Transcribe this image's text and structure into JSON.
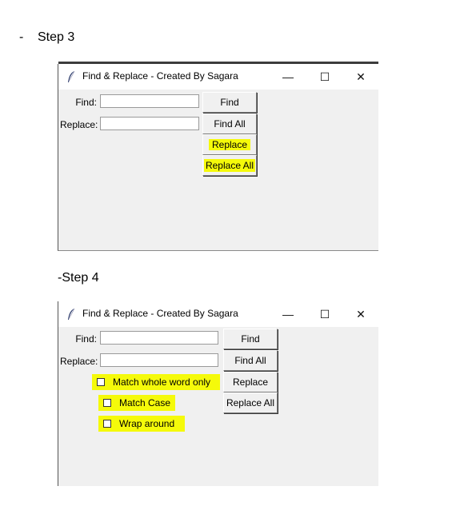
{
  "doc": {
    "bullet": "-",
    "step3_label": "Step 3",
    "step4_label": "-Step 4"
  },
  "window_a": {
    "title": "Find & Replace - Created By Sagara",
    "minimize_glyph": "—",
    "maximize_glyph": "☐",
    "close_glyph": "✕",
    "find_label": "Find:",
    "replace_label": "Replace:",
    "find_value": "",
    "replace_value": "",
    "buttons": [
      "Find",
      "Find All",
      "Replace",
      "Replace All"
    ]
  },
  "window_b": {
    "title": "Find & Replace - Created By Sagara",
    "minimize_glyph": "—",
    "maximize_glyph": "☐",
    "close_glyph": "✕",
    "find_label": "Find:",
    "replace_label": "Replace:",
    "find_value": "",
    "replace_value": "",
    "buttons": [
      "Find",
      "Find All",
      "Replace",
      "Replace All"
    ],
    "checkboxes": [
      {
        "label": "Match whole word only",
        "checked": false
      },
      {
        "label": "Match Case",
        "checked": false
      },
      {
        "label": "Wrap around",
        "checked": false
      }
    ]
  },
  "colors": {
    "highlight": "#f5fa0a",
    "window_bg": "#f0f0f0"
  },
  "icons": {
    "app_icon": "feather-icon"
  }
}
